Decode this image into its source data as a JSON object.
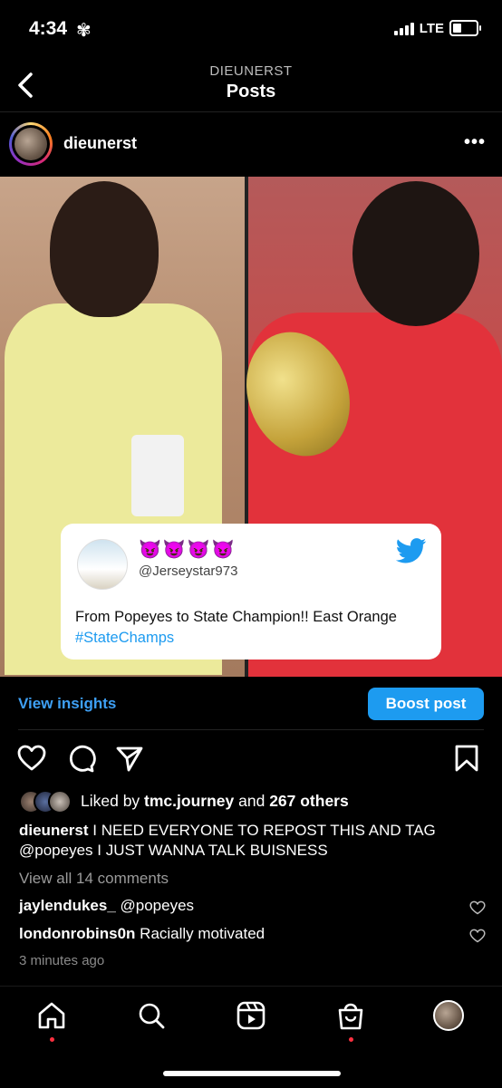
{
  "status_bar": {
    "time": "4:34",
    "network": "LTE",
    "time_icon": "flower-icon"
  },
  "header": {
    "subtitle": "DIEUNERST",
    "title": "Posts"
  },
  "post": {
    "username": "dieunerst",
    "tweet": {
      "emojis": "😈😈😈😈",
      "handle": "@Jerseystar973",
      "text": "From Popeyes to State Champion!! East Orange",
      "hashtag": "#StateChamps"
    },
    "view_insights": "View insights",
    "boost_post": "Boost post",
    "likes": {
      "prefix": "Liked by ",
      "user": "tmc.journey",
      "middle": " and ",
      "count": "267 others"
    },
    "caption": {
      "user": "dieunerst",
      "text": " I NEED EVERYONE TO REPOST THIS AND TAG @popeyes I JUST WANNA TALK BUISNESS"
    },
    "view_all_comments": "View all 14 comments",
    "comments": [
      {
        "user": "jaylendukes_",
        "text": " @popeyes"
      },
      {
        "user": "londonrobins0n",
        "text": " Racially motivated"
      }
    ],
    "time_ago": "3 minutes ago"
  },
  "colors": {
    "accent_blue": "#1d9bf0",
    "link_blue": "#3ea0f5",
    "notification_dot": "#ff3040"
  }
}
